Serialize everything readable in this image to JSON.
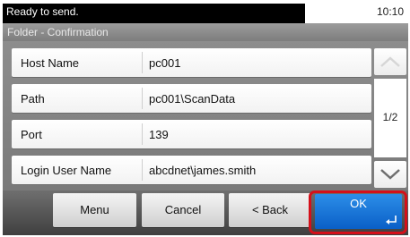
{
  "status": {
    "message": "Ready to send.",
    "time": "10:10"
  },
  "title": "Folder - Confirmation",
  "rows": [
    {
      "label": "Host Name",
      "value": "pc001"
    },
    {
      "label": "Path",
      "value": "pc001\\ScanData"
    },
    {
      "label": "Port",
      "value": "139"
    },
    {
      "label": "Login User Name",
      "value": "abcdnet\\james.smith"
    }
  ],
  "pager": {
    "page": "1/2"
  },
  "buttons": {
    "menu": "Menu",
    "cancel": "Cancel",
    "back": "< Back",
    "ok": "OK"
  },
  "colors": {
    "ok_button": "#1a7ae0",
    "highlight": "#d4101a"
  }
}
